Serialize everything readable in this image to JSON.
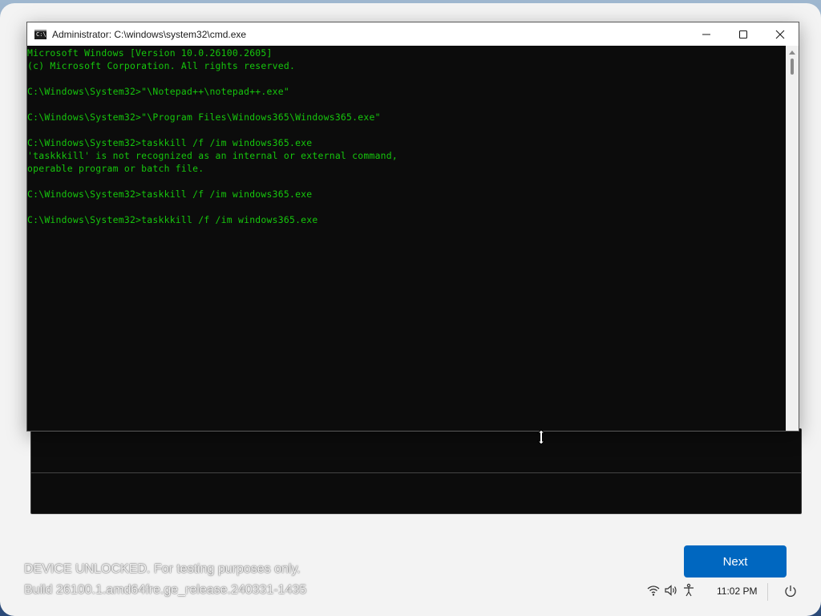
{
  "window": {
    "title": "Administrator: C:\\windows\\system32\\cmd.exe",
    "icon": "cmd-icon",
    "icon_label": "C:\\"
  },
  "console": {
    "text_color": "#16c60c",
    "background": "#0c0c0c",
    "lines": [
      "Microsoft Windows [Version 10.0.26100.2605]",
      "(c) Microsoft Corporation. All rights reserved.",
      "",
      "C:\\Windows\\System32>\"\\Notepad++\\notepad++.exe\"",
      "",
      "C:\\Windows\\System32>\"\\Program Files\\Windows365\\Windows365.exe\"",
      "",
      "C:\\Windows\\System32>taskkill /f /im windows365.exe",
      "'taskkkill' is not recognized as an internal or external command,",
      "operable program or batch file.",
      "",
      "C:\\Windows\\System32>taskkill /f /im windows365.exe",
      "",
      "C:\\Windows\\System32>taskkkill /f /im windows365.exe"
    ]
  },
  "watermark": {
    "line1": "DEVICE UNLOCKED. For testing purposes only.",
    "line2": "Build 26100.1.amd64fre.ge_release.240331-1435"
  },
  "next_button": {
    "label": "Next",
    "color": "#0067c0"
  },
  "tray": {
    "icons": [
      "wifi-icon",
      "volume-icon",
      "accessibility-icon",
      "power-icon"
    ],
    "time": "11:02 PM"
  }
}
